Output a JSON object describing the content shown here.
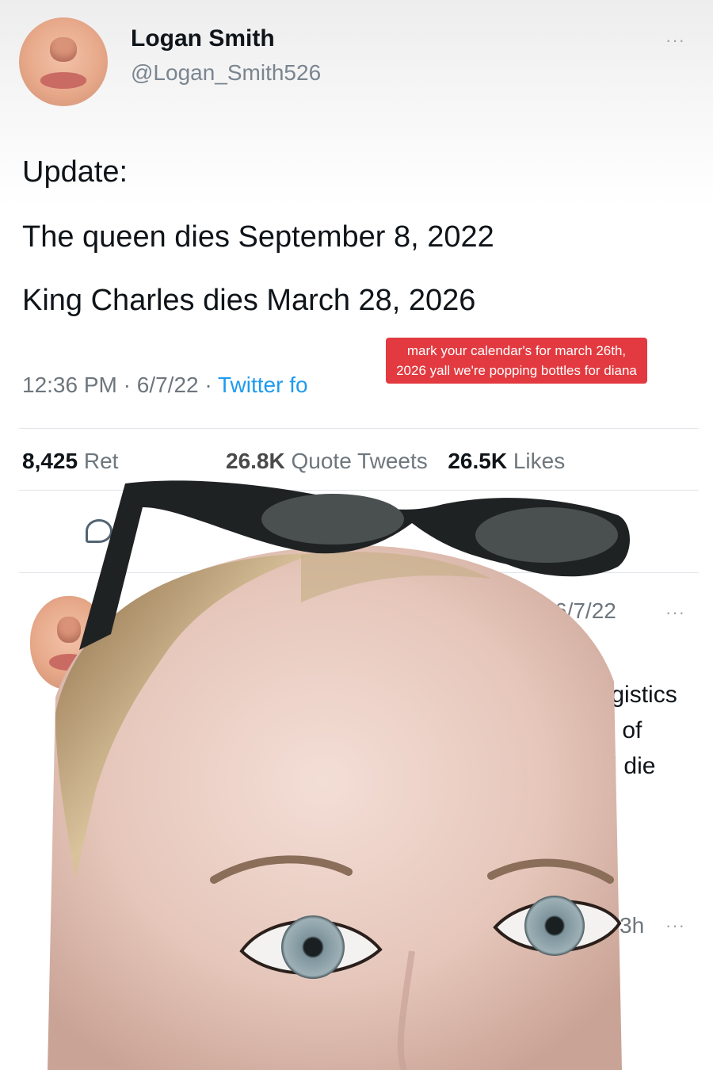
{
  "tweet": {
    "display_name": "Logan Smith",
    "handle": "@Logan_Smith526",
    "more_label": "···",
    "body": [
      "Update:",
      "The queen dies September 8, 2022",
      "King Charles dies March 28, 2026"
    ],
    "time": "12:36 PM",
    "date": "6/7/22",
    "separator": " · ",
    "source_partial": "Twitter fo",
    "stats": {
      "retweets_count": "8,425",
      "retweets_label_partial": "Ret",
      "quotes_count_partial": "26.8K",
      "quotes_label": "Quote Tweets",
      "likes_count": "26.5K",
      "likes_label": "Likes"
    }
  },
  "caption": {
    "text": "mark your calendar's for march 26th, 2026 yall we're popping bottles for diana"
  },
  "reply": {
    "date_partial": "6/7/22",
    "more_label": "···",
    "text_fragments": [
      "logistics",
      "m of",
      "'ll die"
    ],
    "next_time": "3h",
    "next_more": "···"
  },
  "colors": {
    "link": "#1d9bf0",
    "caption_bg": "#e23a40",
    "muted_text": "#6e767d"
  }
}
